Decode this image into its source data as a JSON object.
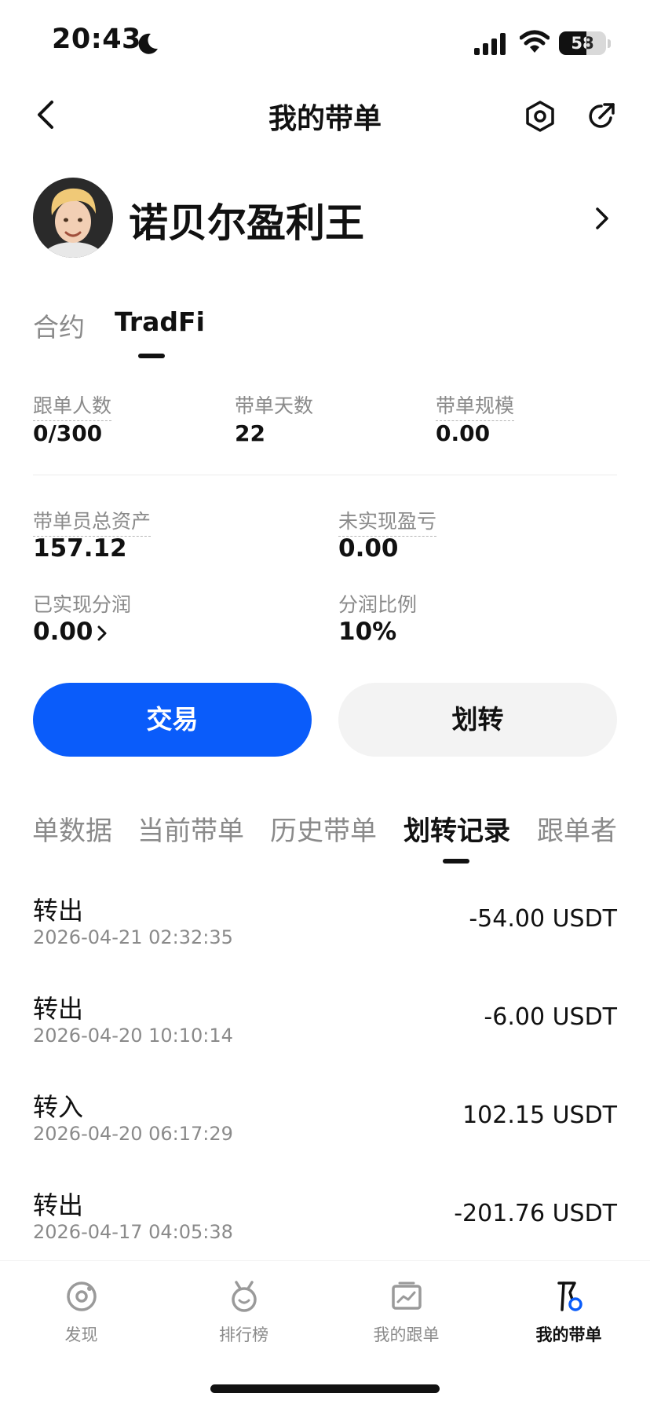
{
  "status_bar": {
    "time": "20:43",
    "battery": "58",
    "battery_level": 0.58,
    "icons": [
      "moon-icon",
      "signal-icon",
      "wifi-icon",
      "battery-icon"
    ]
  },
  "nav": {
    "title": "我的带单",
    "icons": [
      "back-chevron-icon",
      "settings-hexagon-icon",
      "share-icon"
    ]
  },
  "profile": {
    "name": "诺贝尔盈利王"
  },
  "product_tabs": [
    {
      "label": "合约",
      "active": false
    },
    {
      "label": "TradFi",
      "active": true
    }
  ],
  "stats_row1": [
    {
      "label": "跟单人数",
      "value": "0/300"
    },
    {
      "label": "带单天数",
      "value": "22"
    },
    {
      "label": "带单规模",
      "value": "0.00"
    }
  ],
  "stats_row2": [
    {
      "label": "带单员总资产",
      "value": "157.12"
    },
    {
      "label": "未实现盈亏",
      "value": "0.00"
    }
  ],
  "stats_row3": [
    {
      "label": "已实现分润",
      "value": "0.00"
    },
    {
      "label": "分润比例",
      "value": "10%"
    }
  ],
  "buttons": {
    "trade": "交易",
    "transfer": "划转"
  },
  "section_tabs": [
    {
      "label": "单数据",
      "active": false
    },
    {
      "label": "当前带单",
      "active": false
    },
    {
      "label": "历史带单",
      "active": false
    },
    {
      "label": "划转记录",
      "active": true
    },
    {
      "label": "跟单者",
      "active": false
    }
  ],
  "records": [
    {
      "type": "转出",
      "time": "2026-04-21 02:32:35",
      "amount": "-54.00 USDT"
    },
    {
      "type": "转出",
      "time": "2026-04-20 10:10:14",
      "amount": "-6.00 USDT"
    },
    {
      "type": "转入",
      "time": "2026-04-20 06:17:29",
      "amount": "102.15 USDT"
    },
    {
      "type": "转出",
      "time": "2026-04-17 04:05:38",
      "amount": "-201.76 USDT"
    }
  ],
  "tabbar": [
    {
      "label": "发现",
      "icon": "discover-icon",
      "active": false
    },
    {
      "label": "排行榜",
      "icon": "ranking-medal-icon",
      "active": false
    },
    {
      "label": "我的跟单",
      "icon": "my-copy-chart-icon",
      "active": false
    },
    {
      "label": "我的带单",
      "icon": "my-lead-flag-icon",
      "active": true
    }
  ],
  "colors": {
    "accent": "#0a5cfa",
    "text_primary": "#111111",
    "text_secondary": "#8a8a8a",
    "button_secondary_bg": "#f3f3f3"
  }
}
